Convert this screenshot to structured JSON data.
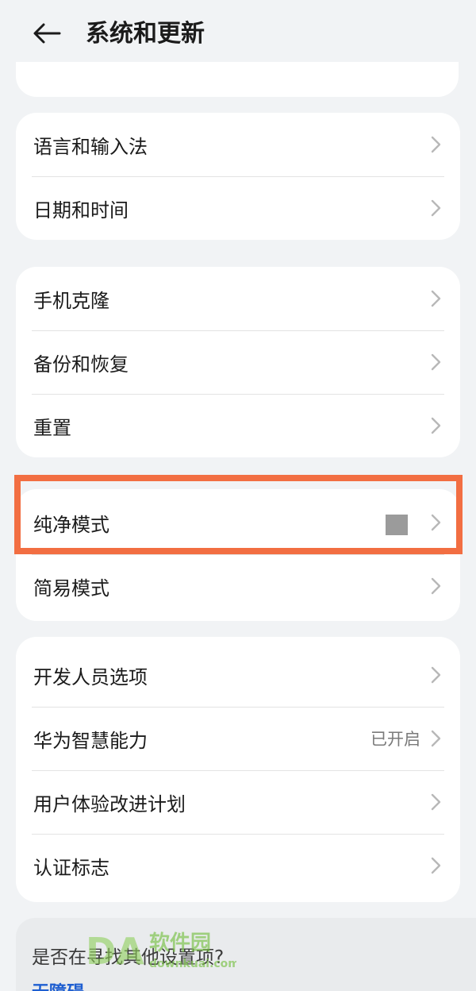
{
  "header": {
    "title": "系统和更新",
    "back_icon": "back-arrow-icon"
  },
  "partial_card": {
    "text": ""
  },
  "groups": [
    {
      "items": [
        {
          "label": "语言和输入法",
          "value": ""
        },
        {
          "label": "日期和时间",
          "value": ""
        }
      ]
    },
    {
      "items": [
        {
          "label": "手机克隆",
          "value": ""
        },
        {
          "label": "备份和恢复",
          "value": ""
        },
        {
          "label": "重置",
          "value": ""
        }
      ]
    },
    {
      "items": [
        {
          "label": "纯净模式",
          "value": ""
        },
        {
          "label": "简易模式",
          "value": ""
        }
      ]
    },
    {
      "items": [
        {
          "label": "开发人员选项",
          "value": ""
        },
        {
          "label": "华为智慧能力",
          "value": "已开启"
        },
        {
          "label": "用户体验改进计划",
          "value": ""
        },
        {
          "label": "认证标志",
          "value": ""
        }
      ]
    }
  ],
  "suggestion": {
    "title": "是否在寻找其他设置项?",
    "link": "无障碍"
  },
  "watermark": {
    "text": "软件园",
    "sub": "downkuai.com",
    "logo_text": "DA"
  },
  "colors": {
    "background": "#f1f3f5",
    "card": "#ffffff",
    "highlight": "#f26e42",
    "link": "#1f5fd1"
  }
}
